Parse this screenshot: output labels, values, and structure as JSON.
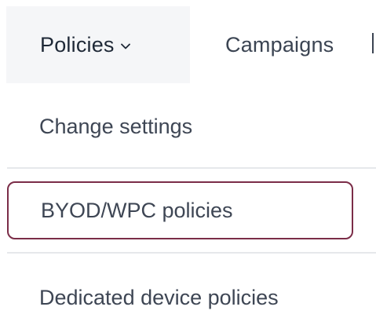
{
  "nav": {
    "active_tab": "Policies",
    "next_tab": "Campaigns"
  },
  "menu": {
    "items": [
      {
        "label": "Change settings"
      },
      {
        "label": "BYOD/WPC policies",
        "focused": true
      },
      {
        "label": "Dedicated device policies"
      }
    ]
  },
  "colors": {
    "focus_outline": "#7b2d48",
    "active_tab_bg": "#f5f6f8",
    "separator": "#e6e8eb",
    "text": "#3e4654"
  },
  "icons": {
    "dropdown": "chevron-down-icon"
  }
}
